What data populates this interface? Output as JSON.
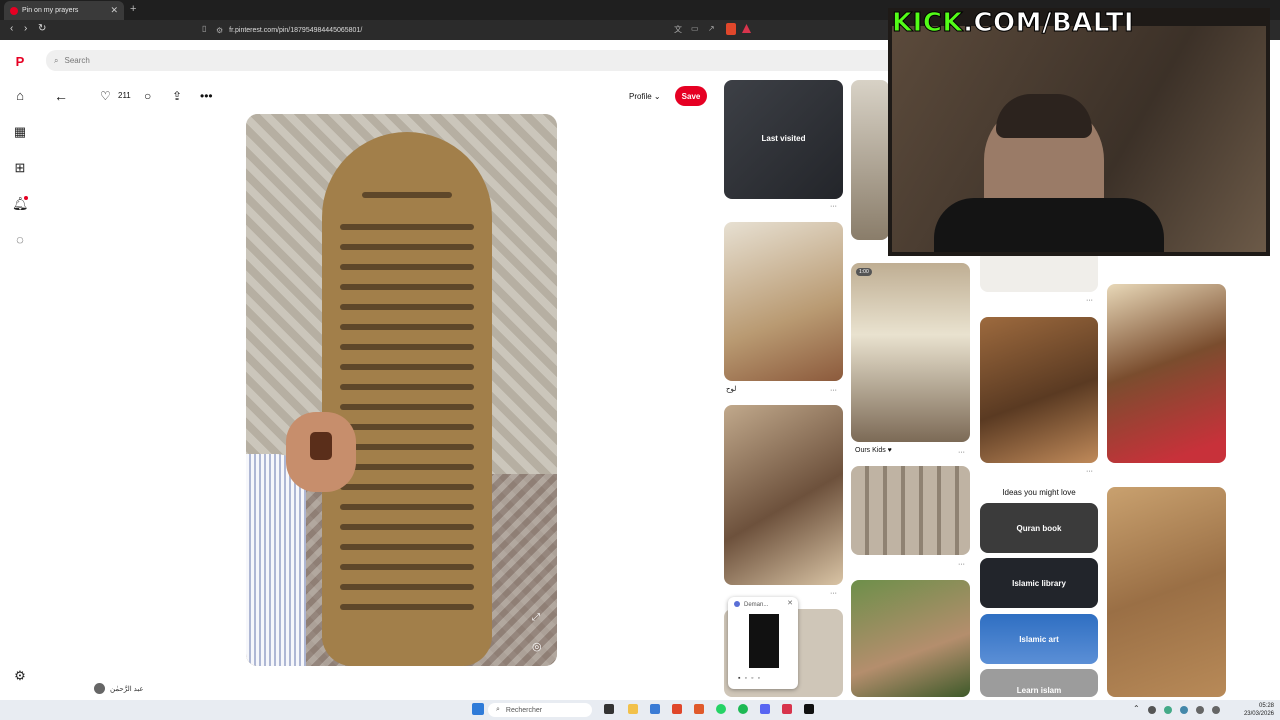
{
  "browser": {
    "tab_title": "Pin on my prayers",
    "url": "fr.pinterest.com/pin/187954984445065801/"
  },
  "search": {
    "placeholder": "Search"
  },
  "pin": {
    "likes": "211",
    "profile_label": "Profile",
    "save_label": "Save",
    "author": "عبد الرَّحمٰن"
  },
  "feed": {
    "last_visited": "Last visited",
    "caption_lawh": "لوح",
    "caption_kids": "Ours Kids ♥",
    "badge_time": "1:00",
    "ideas_heading": "Ideas you might love",
    "ideas": [
      "Quran book",
      "Islamic library",
      "Islamic art",
      "Learn islam"
    ]
  },
  "popup": {
    "title": "Deman..."
  },
  "overlay": {
    "kick_brand": "KICK",
    "kick_rest": ".COM/BALTI"
  },
  "taskbar": {
    "search_label": "Rechercher",
    "time": "05:28",
    "date": "23/03/2026"
  },
  "colors": {
    "brand": "#e60023",
    "kick": "#53fc18"
  }
}
